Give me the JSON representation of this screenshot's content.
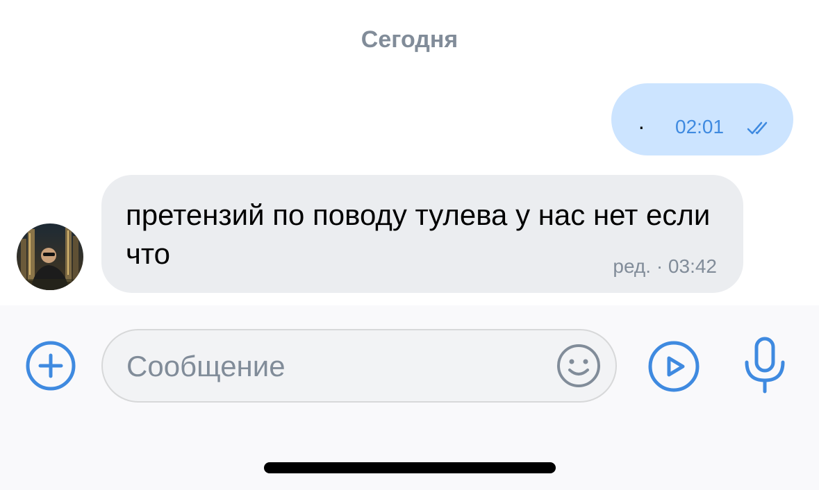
{
  "chat": {
    "date_separator": "Сегодня",
    "messages": [
      {
        "direction": "outgoing",
        "text": "·",
        "time": "02:01",
        "status_icon": "double-check-icon"
      },
      {
        "direction": "incoming",
        "text": "претензий по поводу тулева у нас нет если что",
        "meta": "ред. · 03:42",
        "avatar_icon": "avatar-photo"
      }
    ]
  },
  "composer": {
    "placeholder": "Сообщение",
    "icons": [
      "plus-circle-icon",
      "emoji-icon",
      "video-message-icon",
      "microphone-icon"
    ]
  },
  "colors": {
    "accent": "#3f8ae0",
    "outgoing_bubble": "#cce4ff",
    "incoming_bubble": "#ebedf0",
    "secondary_text": "#818c99"
  }
}
